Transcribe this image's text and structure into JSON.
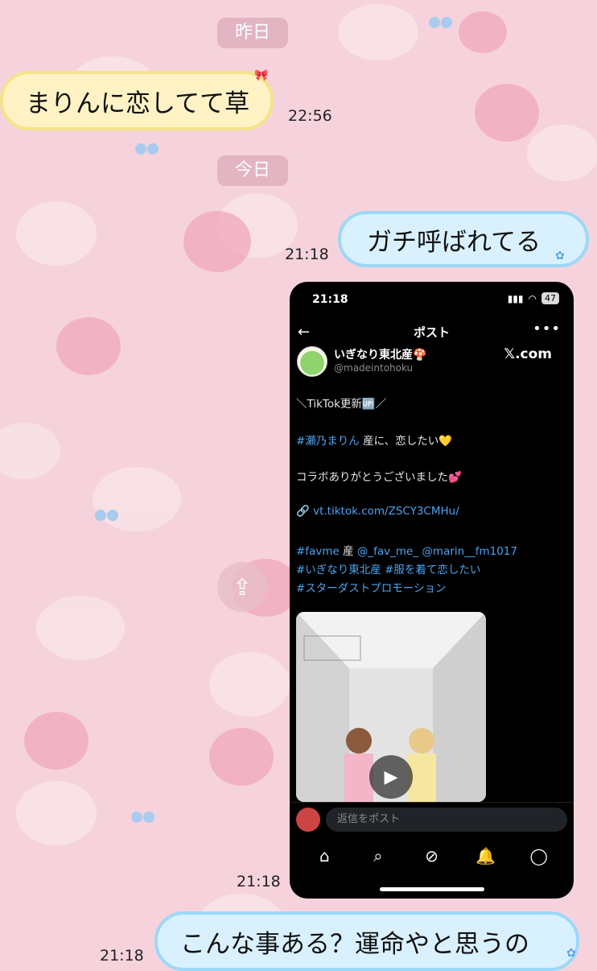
{
  "date_separators": {
    "yesterday": "昨日",
    "today": "今日"
  },
  "messages": [
    {
      "text": "まりんに恋してて草",
      "time": "22:56",
      "side": "in"
    },
    {
      "text": "ガチ呼ばれてる",
      "time": "21:18",
      "side": "out"
    },
    {
      "time": "21:18",
      "side": "out",
      "attachment": "screenshot"
    },
    {
      "text": "こんな事ある？運命やと思うの",
      "time": "21:18",
      "side": "out"
    }
  ],
  "screenshot": {
    "status_time": "21:18",
    "battery": "47",
    "nav_title": "ポスト",
    "author_name": "いぎなり東北産🍄",
    "author_handle": "@madeintohoku",
    "source": "𝕏.com",
    "lines": {
      "l1": "＼TikTok更新🆙／",
      "l2_tag": "#瀬乃まりん",
      "l2_rest": " 産に、恋したい💛",
      "l3": "コラボありがとうございました💕",
      "l4_icon": "🔗",
      "l4_link": "vt.tiktok.com/ZSCY3CMHu/",
      "l5_tag": "#favme",
      "l5_mid": " 産 ",
      "l5_m1": "@_fav_me_",
      "l5_m2": " @marin__fm1017",
      "l6": "#いぎなり東北産 #服を着て恋したい",
      "l7": "#スターダストプロモーション"
    },
    "reply_placeholder": "返信をポスト",
    "tabs": [
      "⌂",
      "⌕",
      "⊘",
      "🔔",
      "◯"
    ]
  },
  "icons": {
    "share": "share-icon",
    "back": "back-arrow-icon",
    "more": "more-icon",
    "play": "play-icon"
  },
  "colors": {
    "background": "#f6d3dc",
    "incoming": "#fff3c6",
    "outgoing": "#d9f1ff",
    "link": "#4aa3ef"
  }
}
